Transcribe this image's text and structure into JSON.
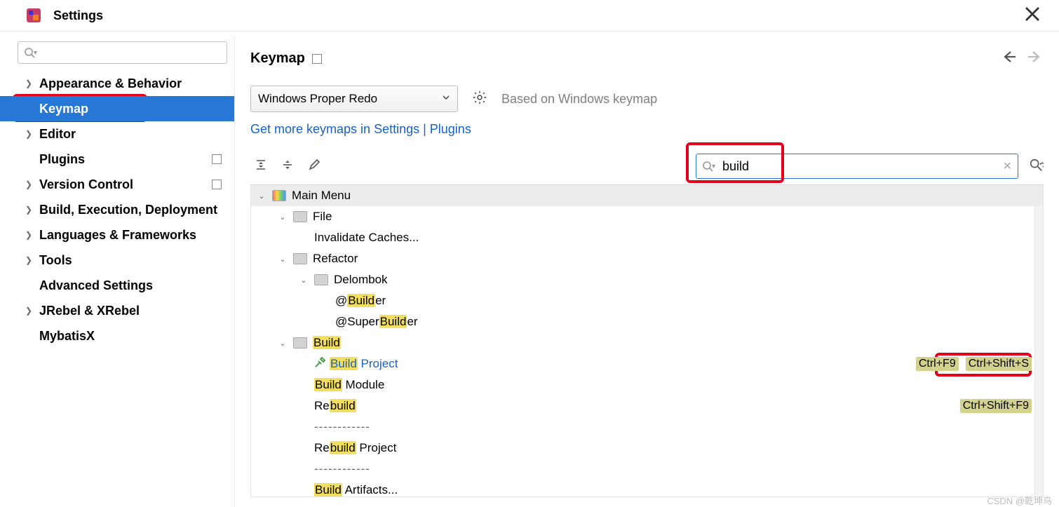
{
  "window": {
    "title": "Settings"
  },
  "sidebar": {
    "search_placeholder": "",
    "items": [
      {
        "label": "Appearance & Behavior",
        "chev": true
      },
      {
        "label": "Keymap",
        "chev": false,
        "selected": true
      },
      {
        "label": "Editor",
        "chev": true
      },
      {
        "label": "Plugins",
        "chev": false,
        "badge": true
      },
      {
        "label": "Version Control",
        "chev": true,
        "badge": true
      },
      {
        "label": "Build, Execution, Deployment",
        "chev": true
      },
      {
        "label": "Languages & Frameworks",
        "chev": true
      },
      {
        "label": "Tools",
        "chev": true
      },
      {
        "label": "Advanced Settings",
        "chev": false
      },
      {
        "label": "JRebel & XRebel",
        "chev": true
      },
      {
        "label": "MybatisX",
        "chev": false
      }
    ]
  },
  "header": {
    "title": "Keymap"
  },
  "scheme": {
    "selected": "Windows Proper Redo",
    "based_on": "Based on Windows keymap",
    "link": "Get more keymaps in Settings | Plugins"
  },
  "search": {
    "value": "build"
  },
  "highlight": "build",
  "tree": {
    "root": {
      "label": "Main Menu"
    },
    "file": {
      "label": "File",
      "items": [
        {
          "label": "Invalidate Caches..."
        }
      ]
    },
    "refactor": {
      "label": "Refactor",
      "delombok": {
        "label": "Delombok",
        "items": [
          {
            "pre": "@",
            "label_match": "Build",
            "post": "er"
          },
          {
            "pre": "@Super",
            "label_match": "Build",
            "post": "er"
          }
        ]
      }
    },
    "build": {
      "label_match": "Build",
      "items": [
        {
          "pre": "",
          "label_match": "Build",
          "post": " Project",
          "blue": true,
          "icon": "hammer",
          "shortcuts": [
            "Ctrl+F9",
            "Ctrl+Shift+S"
          ],
          "shortcut_hl": 1
        },
        {
          "pre": "",
          "label_match": "Build",
          "post": " Module"
        },
        {
          "pre": "Re",
          "label_match": "build",
          "post": "",
          "shortcuts": [
            "Ctrl+Shift+F9"
          ]
        },
        {
          "sep": "------------"
        },
        {
          "pre": "Re",
          "label_match": "build",
          "post": " Project"
        },
        {
          "sep": "------------"
        },
        {
          "pre": "",
          "label_match": "Build",
          "post": " Artifacts..."
        }
      ]
    }
  },
  "watermark": "CSDN @乾坤鸟"
}
